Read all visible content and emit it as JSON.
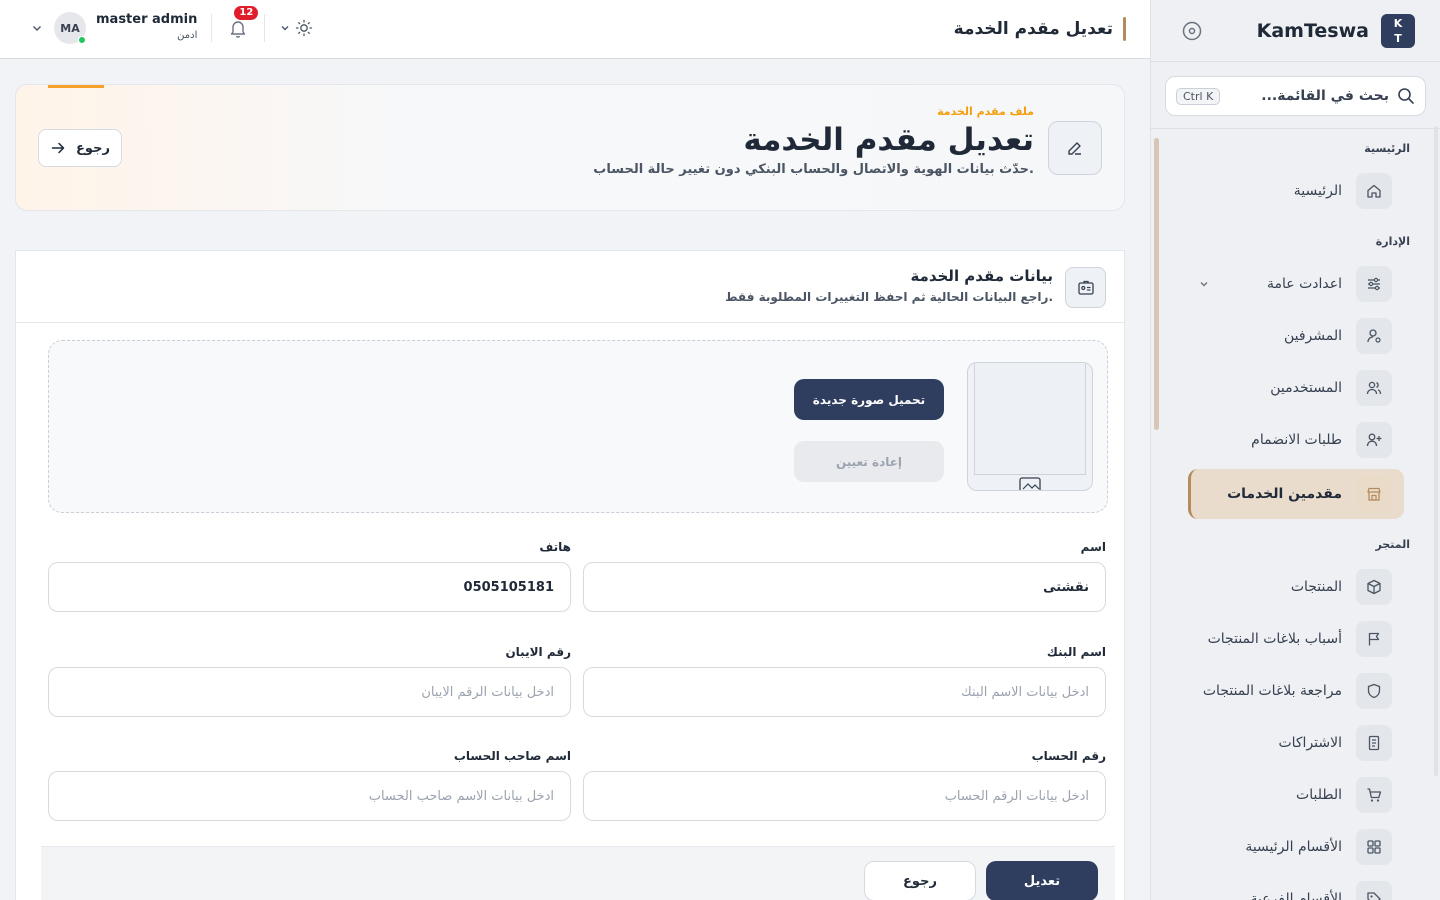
{
  "sidebar": {
    "brand_logo_line1": "K",
    "brand_logo_line2": "T",
    "brand_name": "KamTeswa",
    "search_placeholder": "بحث في القائمة...",
    "search_shortcut": "Ctrl K",
    "sections": {
      "home": "الرئيسية",
      "admin": "الإدارة",
      "store": "المتجر"
    },
    "items": [
      {
        "label": "الرئيسية",
        "icon": "home-icon"
      },
      {
        "label": "اعدادت عامة",
        "icon": "sliders-icon"
      },
      {
        "label": "المشرفين",
        "icon": "user-cog-icon"
      },
      {
        "label": "المستخدمين",
        "icon": "users-icon"
      },
      {
        "label": "طلبات الانضمام",
        "icon": "user-plus-icon"
      },
      {
        "label": "مقدمين الخدمات",
        "icon": "store-icon",
        "active": true
      },
      {
        "label": "المنتجات",
        "icon": "box-icon"
      },
      {
        "label": "أسباب بلاغات المنتجات",
        "icon": "flag-icon"
      },
      {
        "label": "مراجعة بلاغات المنتجات",
        "icon": "shield-icon"
      },
      {
        "label": "الاشتراكات",
        "icon": "receipt-icon"
      },
      {
        "label": "الطلبات",
        "icon": "cart-icon"
      },
      {
        "label": "الأقسام الرئيسية",
        "icon": "grid-icon"
      },
      {
        "label": "الأقسام الفرعية",
        "icon": "tag-icon"
      }
    ]
  },
  "topbar": {
    "title": "تعديل مقدم الخدمة",
    "user_initials": "MA",
    "user_name": "master admin",
    "user_role": "ادمن",
    "notifications_count": "12"
  },
  "hero": {
    "kicker": "ملف مقدم الخدمة",
    "title": "تعديل مقدم الخدمة",
    "subtitle": "حدّث بيانات الهوية والاتصال والحساب البنكي دون تغيير حالة الحساب.",
    "back_label": "رجوع"
  },
  "card": {
    "title": "بيانات مقدم الخدمة",
    "subtitle": "راجع البيانات الحالية ثم احفظ التغييرات المطلوبة فقط.",
    "upload_label": "تحميل صورة جديدة",
    "reset_label": "إعادة تعيين",
    "fields": {
      "name": {
        "label": "اسم",
        "value": "نقشتى"
      },
      "phone": {
        "label": "هاتف",
        "value": "0505105181"
      },
      "bank_name": {
        "label": "اسم البنك",
        "placeholder": "ادخل بيانات الاسم البنك"
      },
      "iban": {
        "label": "رقم الايبان",
        "placeholder": "ادخل بيانات الرقم الايبان"
      },
      "account_number": {
        "label": "رقم الحساب",
        "placeholder": "ادخل بيانات الرقم الحساب"
      },
      "account_holder": {
        "label": "اسم صاحب الحساب",
        "placeholder": "ادخل بيانات الاسم صاحب الحساب"
      }
    },
    "save_label": "تعديل",
    "cancel_label": "رجوع"
  },
  "colors": {
    "primary": "#2f3e5e",
    "accent": "#b58b5e",
    "kicker": "#f59e0b",
    "badge": "#e11d2b"
  }
}
